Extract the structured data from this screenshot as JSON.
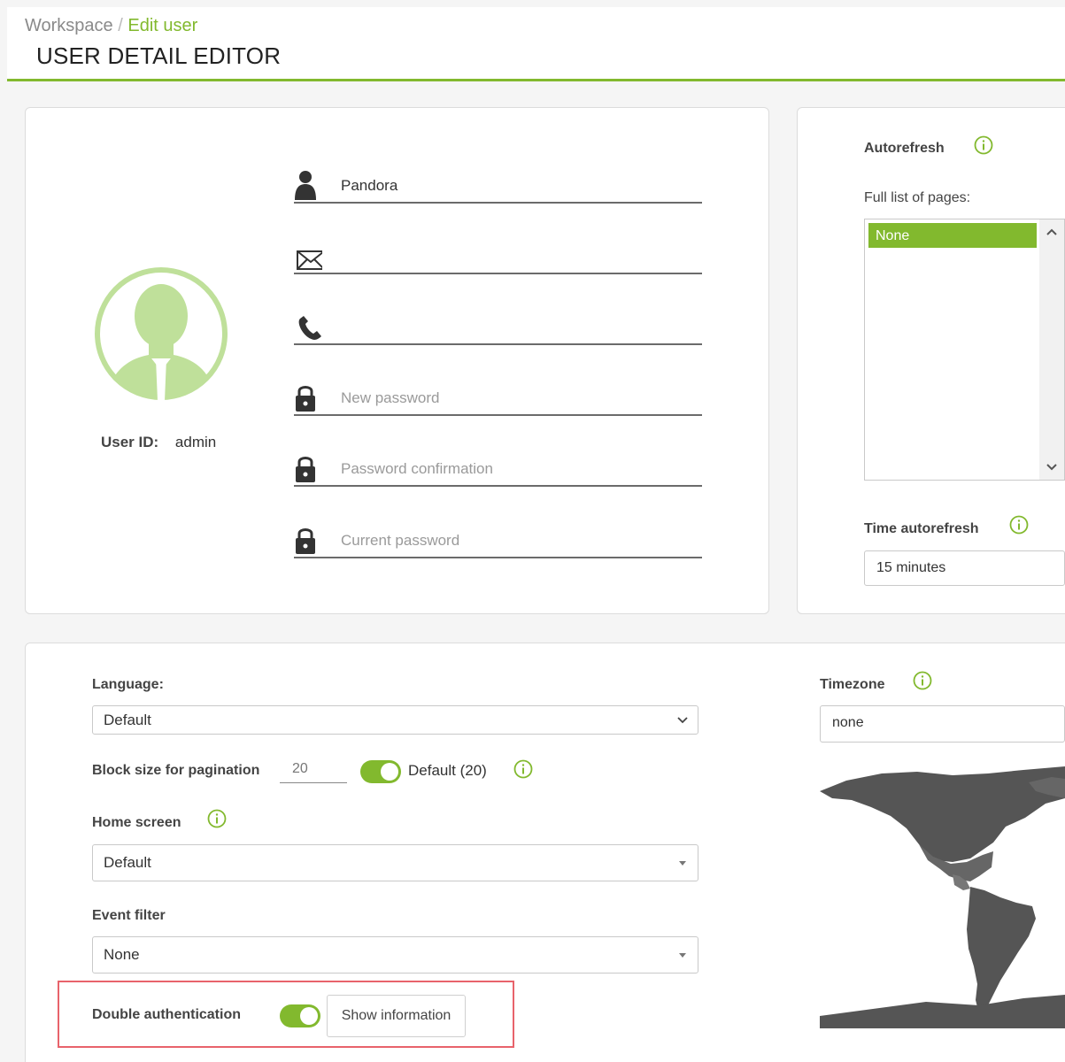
{
  "header": {
    "breadcrumb_root": "Workspace",
    "breadcrumb_sep": "/",
    "breadcrumb_current": "Edit user",
    "title": "USER DETAIL EDITOR"
  },
  "user": {
    "id_label": "User ID:",
    "id_value": "admin",
    "fields": {
      "name_value": "Pandora",
      "email_value": "",
      "phone_value": "",
      "new_password_placeholder": "New password",
      "password_confirm_placeholder": "Password confirmation",
      "current_password_placeholder": "Current password"
    }
  },
  "autorefresh": {
    "title": "Autorefresh",
    "list_label": "Full list of pages:",
    "list_selected": "None",
    "time_label": "Time autorefresh",
    "time_value": "15 minutes"
  },
  "prefs": {
    "language_label": "Language:",
    "language_value": "Default",
    "block_label": "Block size for pagination",
    "block_value": "20",
    "block_default_label": "Default (20)",
    "block_default_on": true,
    "home_label": "Home screen",
    "home_value": "Default",
    "event_label": "Event filter",
    "event_value": "None",
    "double_auth_label": "Double authentication",
    "double_auth_on": true,
    "show_info_label": "Show information",
    "timezone_label": "Timezone",
    "timezone_value": "none"
  },
  "colors": {
    "accent": "#82b92e",
    "avatar": "#bfe09a",
    "highlight": "#e8636b",
    "map": "#555555"
  }
}
